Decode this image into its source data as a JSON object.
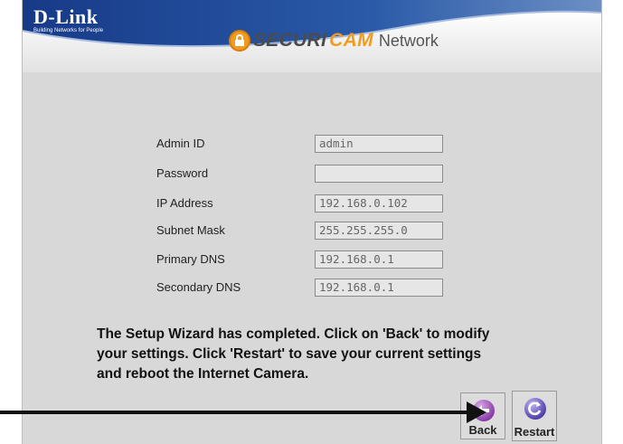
{
  "header": {
    "logo_main": "D-Link",
    "logo_tagline": "Building Networks for People",
    "product_part1": "SECURI",
    "product_part2": "CAM",
    "product_suffix": "Network"
  },
  "form": {
    "fields": [
      {
        "label": "Admin ID",
        "value": "admin"
      },
      {
        "label": "Password",
        "value": ""
      },
      {
        "label": "IP Address",
        "value": "192.168.0.102"
      },
      {
        "label": "Subnet Mask",
        "value": "255.255.255.0"
      },
      {
        "label": "Primary DNS",
        "value": "192.168.0.1"
      },
      {
        "label": "Secondary DNS",
        "value": "192.168.0.1"
      }
    ]
  },
  "message": {
    "line1": "The Setup Wizard has completed. Click on 'Back' to modify",
    "line2": "your settings. Click 'Restart' to save your current settings",
    "line3": "and reboot the Internet Camera."
  },
  "buttons": {
    "back_label": "Back",
    "restart_label": "Restart"
  },
  "colors": {
    "header_blue": "#1a3d8c",
    "accent_orange": "#f29c1f",
    "panel_gray": "#d8d8d8"
  }
}
